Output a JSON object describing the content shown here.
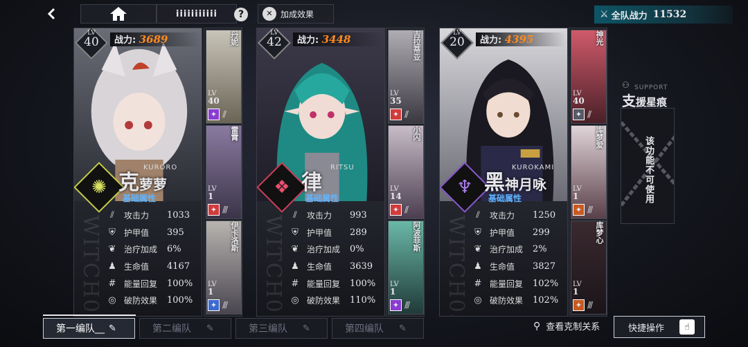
{
  "topbar": {
    "back_icon": "back-arrow-icon",
    "home_icon": "home-icon",
    "name_text": "iiiiiiiiiii",
    "help_icon": "question-icon",
    "bonus_label": "加成效果",
    "team_power_label": "全队战力",
    "team_power_value": "11532"
  },
  "cards": [
    {
      "level_label": "LV",
      "level": "40",
      "power_label": "战力:",
      "power": "3689",
      "name_main": "克",
      "name_rest": "萝萝",
      "romaji": "KURORO",
      "section_label": "基础属性",
      "watermark": "WITCH02",
      "accent": "#c8d04a",
      "stats": [
        {
          "label": "攻击力",
          "value": "1033",
          "icon": "claw-icon"
        },
        {
          "label": "护甲值",
          "value": "395",
          "icon": "shield-icon"
        },
        {
          "label": "治疗加成",
          "value": "6%",
          "icon": "heal-icon"
        },
        {
          "label": "生命值",
          "value": "4167",
          "icon": "health-icon"
        },
        {
          "label": "能量回复",
          "value": "100%",
          "icon": "energy-icon"
        },
        {
          "label": "破防效果",
          "value": "100%",
          "icon": "break-icon"
        }
      ]
    },
    {
      "level_label": "LV",
      "level": "42",
      "power_label": "战力:",
      "power": "3448",
      "name_main": "律",
      "name_rest": "",
      "romaji": "RITSU",
      "section_label": "基础属性",
      "watermark": "WITCH01",
      "accent": "#d0405a",
      "stats": [
        {
          "label": "攻击力",
          "value": "993",
          "icon": "claw-icon"
        },
        {
          "label": "护甲值",
          "value": "289",
          "icon": "shield-icon"
        },
        {
          "label": "治疗加成",
          "value": "0%",
          "icon": "heal-icon"
        },
        {
          "label": "生命值",
          "value": "3639",
          "icon": "health-icon"
        },
        {
          "label": "能量回复",
          "value": "100%",
          "icon": "energy-icon"
        },
        {
          "label": "破防效果",
          "value": "110%",
          "icon": "break-icon"
        }
      ]
    },
    {
      "level_label": "LV",
      "level": "20",
      "power_label": "战力:",
      "power": "4395",
      "name_main": "黑",
      "name_rest": "神月咏",
      "romaji": "KUROKAMI",
      "section_label": "基础属性",
      "watermark": "WITCH03",
      "accent": "#8a5ad0",
      "stats": [
        {
          "label": "攻击力",
          "value": "1250",
          "icon": "claw-icon"
        },
        {
          "label": "护甲值",
          "value": "299",
          "icon": "shield-icon"
        },
        {
          "label": "治疗加成",
          "value": "2%",
          "icon": "heal-icon"
        },
        {
          "label": "生命值",
          "value": "3827",
          "icon": "health-icon"
        },
        {
          "label": "能量回复",
          "value": "102%",
          "icon": "energy-icon"
        },
        {
          "label": "破防效果",
          "value": "102%",
          "icon": "break-icon"
        }
      ]
    }
  ],
  "subs": [
    [
      {
        "name": "丹妮",
        "lv_label": "LV",
        "lv": "40",
        "badge_color": "#8a3bd0"
      },
      {
        "name": "雷霄",
        "lv_label": "LV",
        "lv": "1",
        "badge_color": "#d03b3b"
      },
      {
        "name": "伊卡洛斯",
        "lv_label": "LV",
        "lv": "1",
        "badge_color": "#3b6ad0"
      }
    ],
    [
      {
        "name": "吉拉蒂亚",
        "lv_label": "LV",
        "lv": "35",
        "badge_color": "#d03b3b"
      },
      {
        "name": "小闪",
        "lv_label": "LV",
        "lv": "14",
        "badge_color": "#d03b3b"
      },
      {
        "name": "阿波菲斯",
        "lv_label": "LV",
        "lv": "1",
        "badge_color": "#8a3bd0"
      }
    ],
    [
      {
        "name": "神光",
        "lv_label": "LV",
        "lv": "40",
        "badge_color": "#555a66"
      },
      {
        "name": "库梦爱",
        "lv_label": "LV",
        "lv": "1",
        "badge_color": "#c85a20"
      },
      {
        "name": "库梦心",
        "lv_label": "LV",
        "lv": "1",
        "badge_color": "#c85a20"
      }
    ]
  ],
  "support": {
    "title_big": "支",
    "title_rest": "援星痕",
    "title_en": "SUPPORT",
    "locked_text": "该功能不可使用"
  },
  "tabs": [
    {
      "label": "第一编队",
      "active": true
    },
    {
      "label": "第二编队",
      "active": false
    },
    {
      "label": "第三编队",
      "active": false
    },
    {
      "label": "第四编队",
      "active": false
    }
  ],
  "bottom": {
    "relations_label": "查看克制关系",
    "quick_label": "快捷操作"
  }
}
